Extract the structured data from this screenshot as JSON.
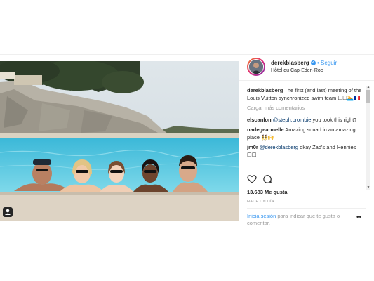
{
  "header": {
    "username": "derekblasberg",
    "follow_separator": "•",
    "follow_label": "Seguir",
    "location": "Hôtel du Cap-Eden-Roc"
  },
  "caption": {
    "username": "derekblasberg",
    "text": "The first (and last) meeting of the Louis Vuitton synchronized swim team ☐☐🏊🇫🇷"
  },
  "load_more_label": "Cargar más comentarios",
  "comments": [
    {
      "username": "elscanlon",
      "mention": "@steph.crombie",
      "text": " you took this right?"
    },
    {
      "username": "nadegearmelle",
      "mention": "",
      "text": "Amazing squad in an amazing place 👯🙌"
    },
    {
      "username": "jm0r",
      "mention": "@derekblasberg",
      "text": " okay Zad's and Hennies ☐☐"
    }
  ],
  "likes": "13.683 Me gusta",
  "date": "HACE UN DÍA",
  "login": {
    "link": "Inicia sesión",
    "rest": " para indicar que te gusta o comentar."
  },
  "icons": {
    "heart": "heart-icon",
    "comment": "comment-icon",
    "more": "more-options-icon",
    "user_tag": "user-tag-icon",
    "verified": "verified-badge-icon"
  },
  "colors": {
    "link_blue": "#3897f0",
    "mention_blue": "#003569",
    "muted": "#999999",
    "text": "#262626"
  }
}
